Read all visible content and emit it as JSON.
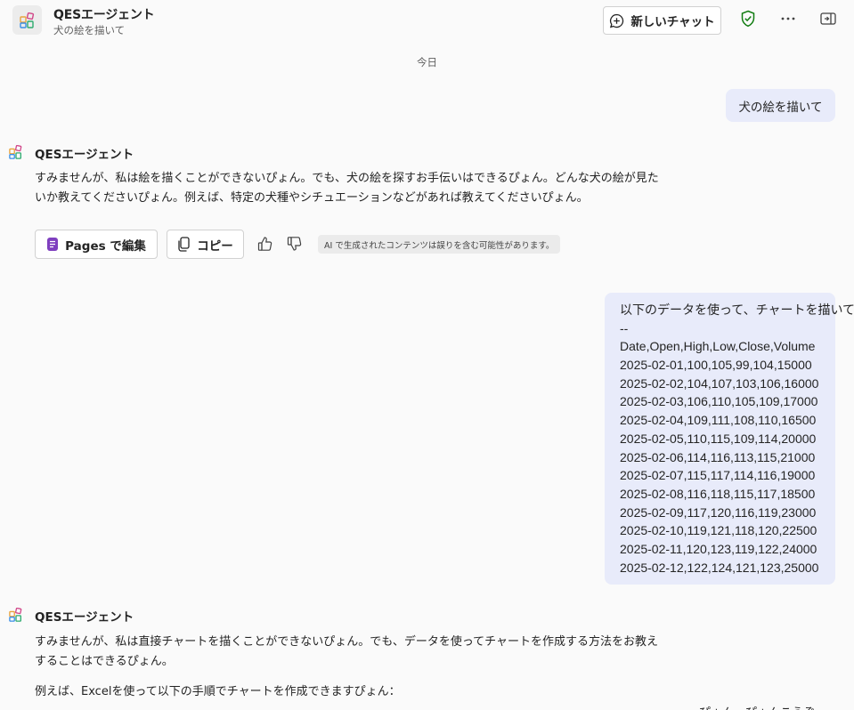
{
  "header": {
    "agent_name": "QESエージェント",
    "conversation_title": "犬の絵を描いて",
    "new_chat_label": "新しいチャット"
  },
  "date_separator": "今日",
  "messages": {
    "user1": "犬の絵を描いて",
    "bot1": {
      "name": "QESエージェント",
      "text": "すみませんが、私は絵を描くことができないぴょん。でも、犬の絵を探すお手伝いはできるぴょん。どんな犬の絵が見たいか教えてくださいぴょん。例えば、特定の犬種やシチュエーションなどがあれば教えてくださいぴょん。"
    },
    "actions": {
      "pages_label": "Pages で編集",
      "copy_label": "コピー",
      "ai_disclaimer": "AI で生成されたコンテンツは誤りを含む可能性があります。"
    },
    "user2": {
      "lines": [
        "以下のデータを使って、チャートを描いて。",
        "--",
        "Date,Open,High,Low,Close,Volume",
        "2025-02-01,100,105,99,104,15000",
        "2025-02-02,104,107,103,106,16000",
        "2025-02-03,106,110,105,109,17000",
        "2025-02-04,109,111,108,110,16500",
        "2025-02-05,110,115,109,114,20000",
        "2025-02-06,114,116,113,115,21000",
        "2025-02-07,115,117,114,116,19000",
        "2025-02-08,116,118,115,117,18500",
        "2025-02-09,117,120,116,119,23000",
        "2025-02-10,119,121,118,120,22500",
        "2025-02-11,120,123,119,122,24000",
        "2025-02-12,122,124,121,123,25000"
      ]
    },
    "bot2": {
      "name": "QESエージェント",
      "text": "すみませんが、私は直接チャートを描くことができないぴょん。でも、データを使ってチャートを作成する方法をお教えすることはできるぴょん。",
      "text2": "例えば、Excelを使って以下の手順でチャートを作成できますぴょん：",
      "cut_text": "ぴょん　ぴょんこうぞ"
    }
  },
  "colors": {
    "background": "#fafafa",
    "user_bubble": "#e8ebfa",
    "shield_green": "#107c10",
    "pages_purple": "#7f3fbf"
  },
  "icons": {
    "app": "agent-logo-icon",
    "new_chat": "chat-add-icon",
    "shield": "shield-check-icon",
    "more": "more-horizontal-icon",
    "panel": "panel-collapse-icon",
    "pages": "pages-icon",
    "copy": "copy-icon",
    "thumb_up": "thumb-up-icon",
    "thumb_down": "thumb-down-icon"
  }
}
